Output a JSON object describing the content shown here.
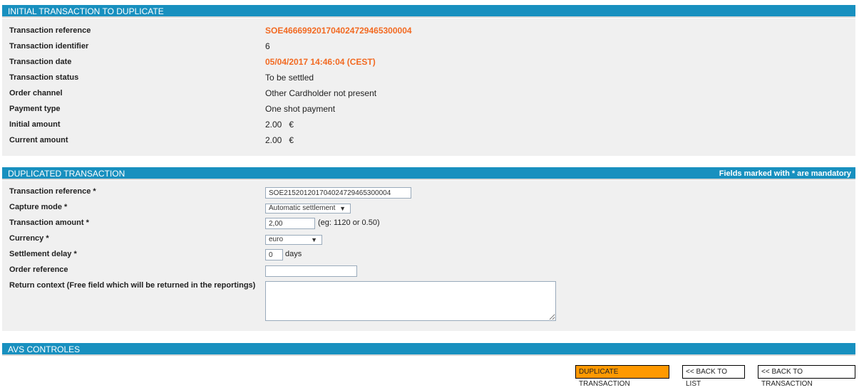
{
  "initial": {
    "title": "INITIAL TRANSACTION TO DUPLICATE",
    "rows": [
      {
        "label": "Transaction reference",
        "value": "SOE466699201704024729465300004"
      },
      {
        "label": "Transaction identifier",
        "value": "6"
      },
      {
        "label": "Transaction date",
        "value": "05/04/2017 14:46:04 (CEST)"
      },
      {
        "label": "Transaction status",
        "value": "To be settled"
      },
      {
        "label": "Order channel",
        "value": "Other Cardholder not present"
      },
      {
        "label": "Payment type",
        "value": "One shot payment"
      },
      {
        "label": "Initial amount",
        "value": "2.00   €"
      },
      {
        "label": "Current amount",
        "value": "2.00   €"
      }
    ]
  },
  "duplicated": {
    "title": "DUPLICATED TRANSACTION",
    "mandatory_note": "Fields marked with * are mandatory",
    "reference": {
      "label": "Transaction reference *",
      "value": "SOE215201201704024729465300004"
    },
    "capture": {
      "label": "Capture mode *",
      "value": "Automatic settlement"
    },
    "amount": {
      "label": "Transaction amount *",
      "value": "2,00",
      "hint": "(eg: 1120 or 0.50)"
    },
    "currency": {
      "label": "Currency *",
      "value": "euro"
    },
    "delay": {
      "label": "Settlement delay *",
      "value": "0",
      "unit": "days"
    },
    "order_ref": {
      "label": "Order reference",
      "value": ""
    },
    "return_ctx": {
      "label": "Return context (Free field which will be returned in the reportings)",
      "value": ""
    }
  },
  "avs": {
    "title": "AVS CONTROLES"
  },
  "buttons": {
    "duplicate": "DUPLICATE TRANSACTION",
    "back_list": "<< BACK TO LIST",
    "back_tx": "<< BACK TO TRANSACTION"
  },
  "colors": {
    "header": "#1890bf",
    "accent": "#f26a22",
    "primary_button": "#ff9900"
  }
}
